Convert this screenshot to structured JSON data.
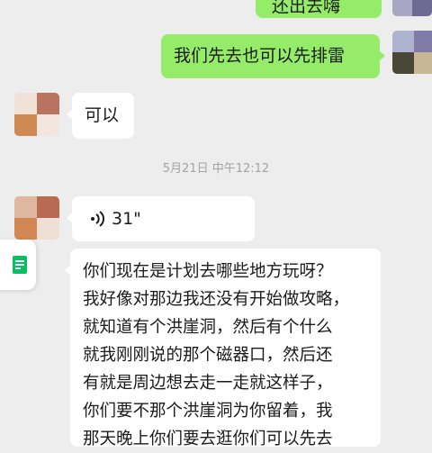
{
  "messages": {
    "sent_partial": "还出去嗨",
    "sent_mine_sweep": "我们先去也可以先排雷",
    "received_ok": "可以",
    "timestamp": "5月21日 中午12:12",
    "voice_duration": "31\"",
    "long_message": {
      "lines": [
        "你们现在是计划去哪些地方玩呀？",
        "我好像对那边我还没有开始做攻略，",
        "就知道有个洪崖洞，然后有个什么",
        "就我刚刚说的那个磁器口，然后还",
        "有就是周边想去走一走就这样子，",
        "你们要不那个洪崖洞为你留着，我",
        "那天晚上你们要去逛你们可以先去"
      ]
    }
  },
  "icons": {
    "voice": "voice-wave-icon",
    "side_app": "document-icon"
  },
  "colors": {
    "background": "#ededed",
    "sent_bubble": "#95ec69",
    "received_bubble": "#ffffff",
    "side_icon": "#07c160"
  }
}
